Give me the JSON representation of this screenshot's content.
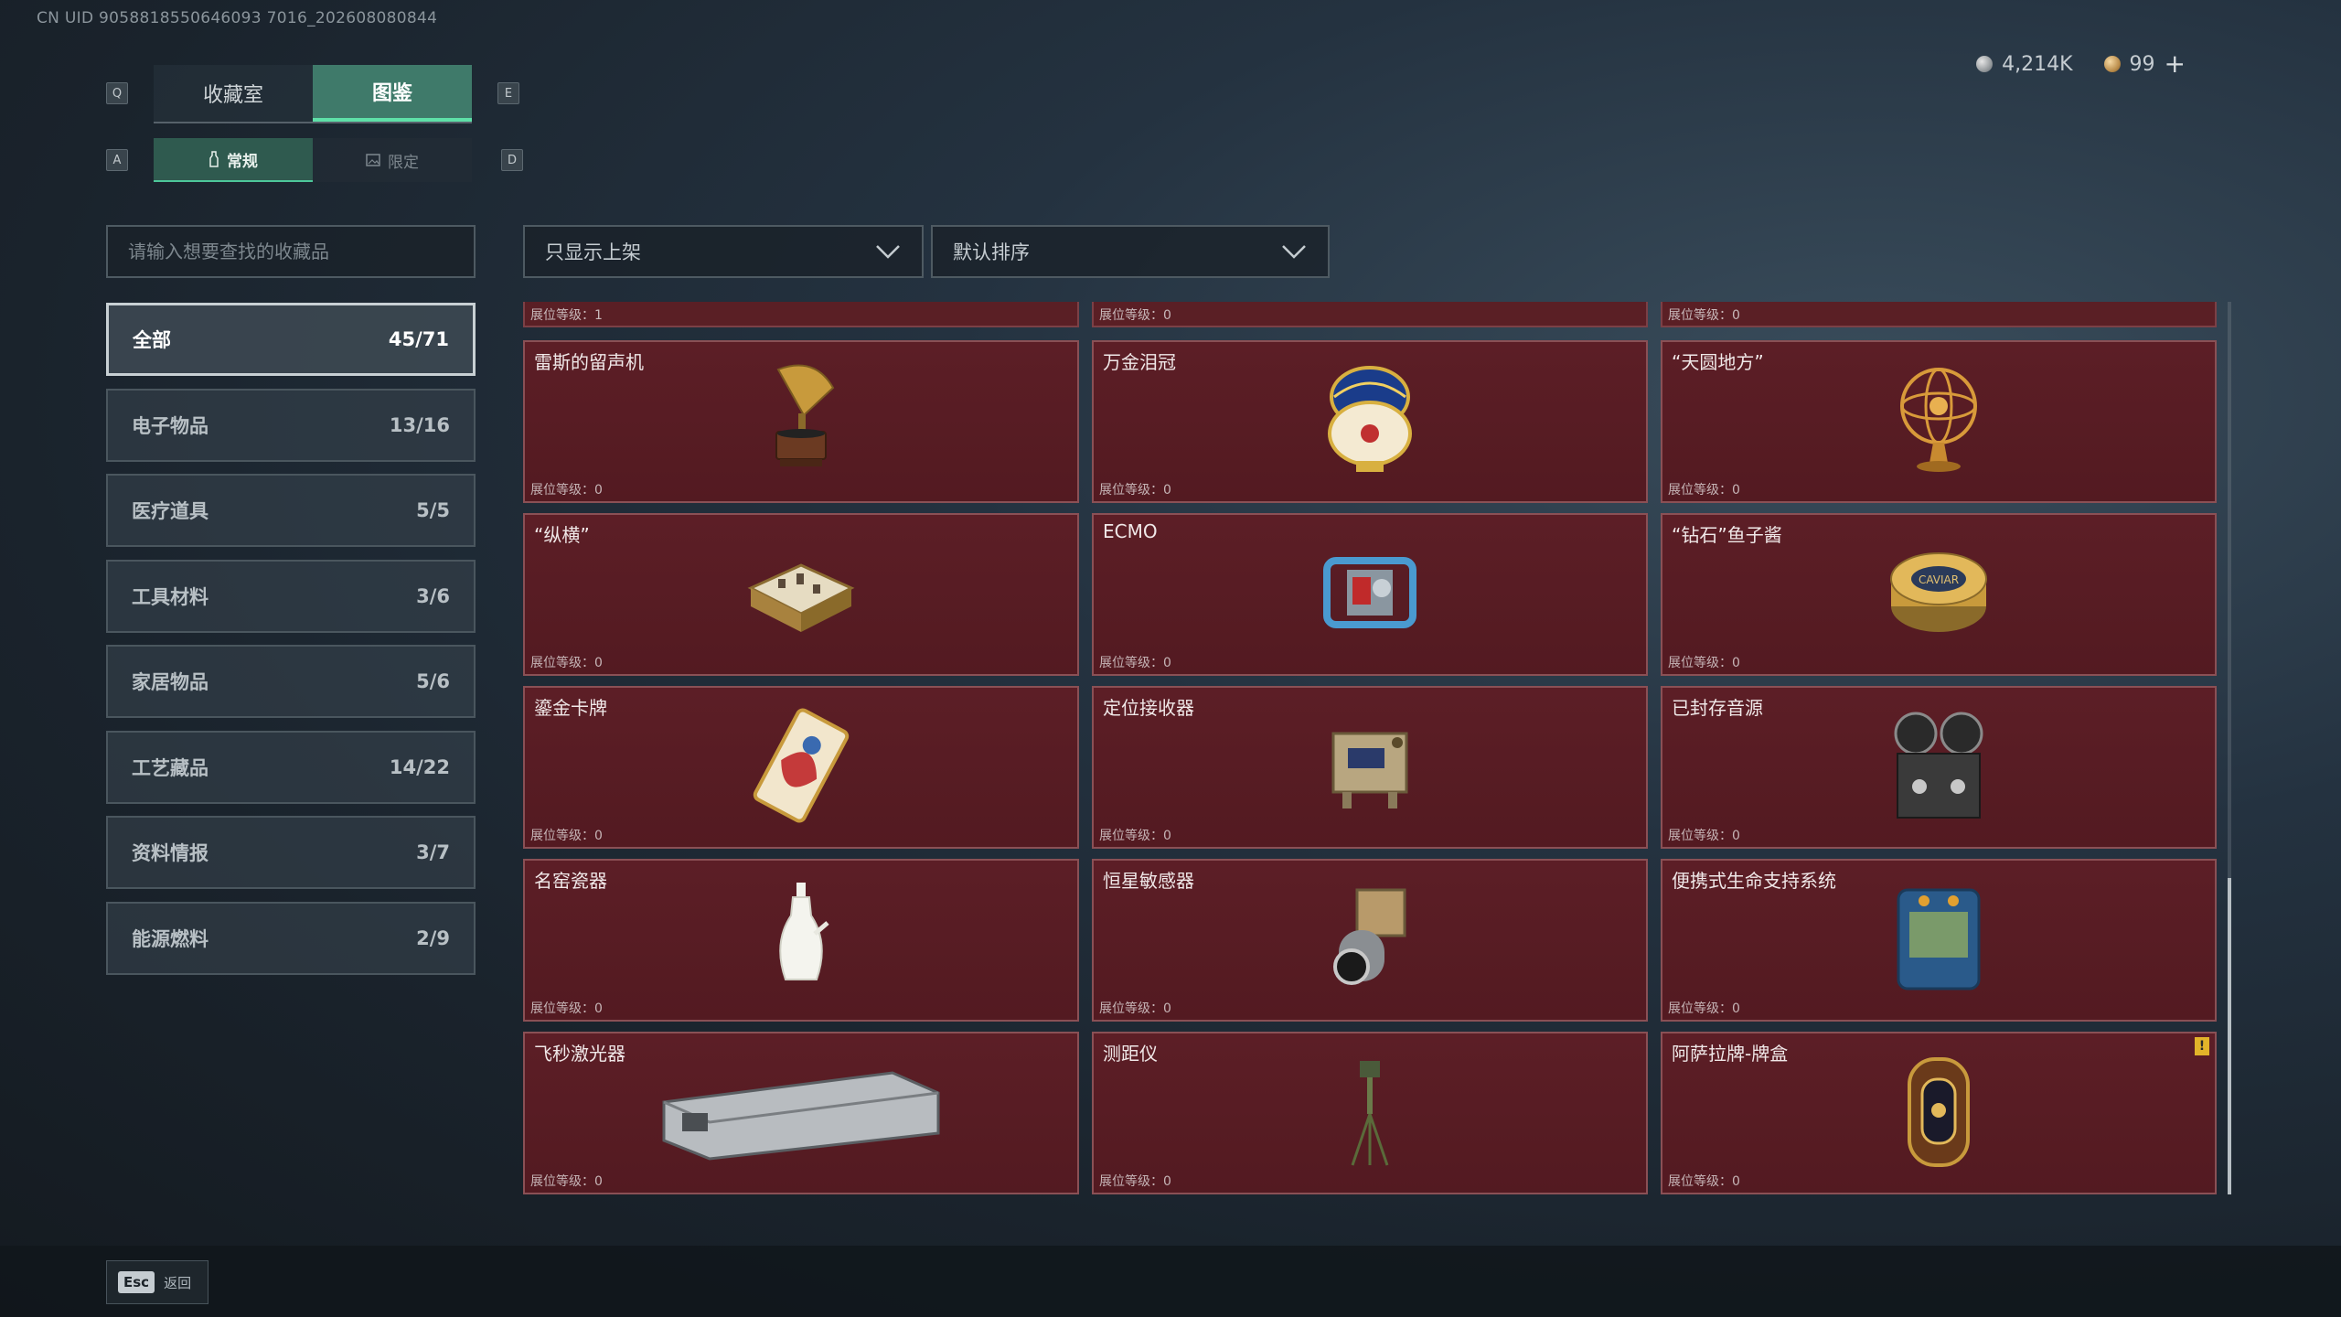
{
  "uid": "CN UID 9058818550646093 7016_202608080844",
  "currency": {
    "silver": "4,214K",
    "gold": "99",
    "plus": "+"
  },
  "keys": {
    "prev_tab": "Q",
    "next_tab": "E",
    "prev_sub": "A",
    "next_sub": "D"
  },
  "tabs": [
    {
      "label": "收藏室",
      "active": false
    },
    {
      "label": "图鉴",
      "active": true
    }
  ],
  "subtabs": [
    {
      "label": "常规",
      "icon": "bottle-icon",
      "active": true
    },
    {
      "label": "限定",
      "icon": "image-icon",
      "active": false
    }
  ],
  "search": {
    "placeholder": "请输入想要查找的收藏品"
  },
  "filters": {
    "shelf": "只显示上架",
    "sort": "默认排序"
  },
  "categories": [
    {
      "label": "全部",
      "count": "45/71",
      "active": true
    },
    {
      "label": "电子物品",
      "count": "13/16"
    },
    {
      "label": "医疗道具",
      "count": "5/5"
    },
    {
      "label": "工具材料",
      "count": "3/6"
    },
    {
      "label": "家居物品",
      "count": "5/6"
    },
    {
      "label": "工艺藏品",
      "count": "14/22"
    },
    {
      "label": "资料情报",
      "count": "3/7"
    },
    {
      "label": "能源燃料",
      "count": "2/9"
    }
  ],
  "top_strip": [
    "展位等级：1",
    "展位等级：0",
    "展位等级：0"
  ],
  "items": [
    {
      "name": "雷斯的留声机",
      "level": "展位等级：0",
      "icon": "gramophone-icon"
    },
    {
      "name": "万金泪冠",
      "level": "展位等级：0",
      "icon": "jeweled-egg-icon"
    },
    {
      "name": "“天圆地方”",
      "level": "展位等级：0",
      "icon": "armillary-sphere-icon"
    },
    {
      "name": "“纵横”",
      "level": "展位等级：0",
      "icon": "chess-box-icon"
    },
    {
      "name": "ECMO",
      "level": "展位等级：0",
      "icon": "ecmo-machine-icon"
    },
    {
      "name": "“钻石”鱼子酱",
      "level": "展位等级：0",
      "icon": "caviar-tin-icon"
    },
    {
      "name": "鎏金卡牌",
      "level": "展位等级：0",
      "icon": "gilded-card-icon"
    },
    {
      "name": "定位接收器",
      "level": "展位等级：0",
      "icon": "gps-receiver-icon"
    },
    {
      "name": "已封存音源",
      "level": "展位等级：0",
      "icon": "reel-recorder-icon"
    },
    {
      "name": "名窑瓷器",
      "level": "展位等级：0",
      "icon": "porcelain-vase-icon"
    },
    {
      "name": "恒星敏感器",
      "level": "展位等级：0",
      "icon": "star-sensor-icon"
    },
    {
      "name": "便携式生命支持系统",
      "level": "展位等级：0",
      "icon": "life-support-icon"
    },
    {
      "name": "飞秒激光器",
      "level": "展位等级：0",
      "icon": "laser-case-icon"
    },
    {
      "name": "测距仪",
      "level": "展位等级：0",
      "icon": "rangefinder-tripod-icon"
    },
    {
      "name": "阿萨拉牌-牌盒",
      "level": "展位等级：0",
      "icon": "card-box-icon",
      "warning": "!"
    }
  ],
  "footer": {
    "key": "Esc",
    "label": "返回"
  }
}
